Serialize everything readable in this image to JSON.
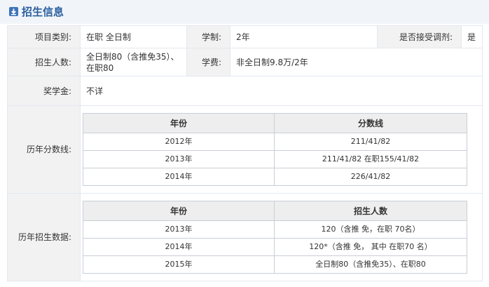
{
  "section": {
    "title": "招生信息",
    "icon": "download-arrow-icon"
  },
  "rows": {
    "category": {
      "label": "项目类别:",
      "value": "在职  全日制"
    },
    "duration": {
      "label": "学制:",
      "value": "2年"
    },
    "adjustment": {
      "label": "是否接受调剂:",
      "value": "是"
    },
    "enrollment": {
      "label": "招生人数:",
      "value": "全日制80（含推免35）、在职80"
    },
    "tuition": {
      "label": "学费:",
      "value": "非全日制9.8万/2年"
    },
    "scholarship": {
      "label": "奖学金:",
      "value": "不详"
    },
    "score_history_label": "历年分数线:",
    "enroll_history_label": "历年招生数据:"
  },
  "scores": {
    "headers": [
      "年份",
      "分数线"
    ],
    "rows": [
      [
        "2012年",
        "211/41/82"
      ],
      [
        "2013年",
        "211/41/82 在职155/41/82"
      ],
      [
        "2014年",
        "226/41/82"
      ]
    ]
  },
  "enrollment_history": {
    "headers": [
      "年份",
      "招生人数"
    ],
    "rows": [
      [
        "2013年",
        "120（含推 免，在职 70名）"
      ],
      [
        "2014年",
        "120*（含推 免， 其中 在职70 名）"
      ],
      [
        "2015年",
        "全日制80（含推免35）、在职80"
      ]
    ]
  }
}
